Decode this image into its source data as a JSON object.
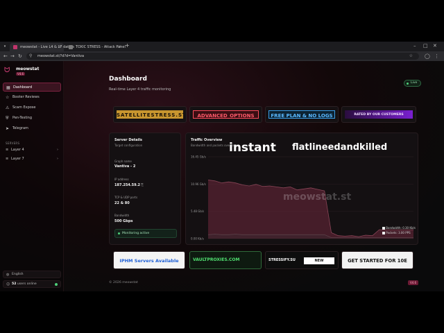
{
  "browser": {
    "tabs": [
      {
        "title": "meowstat - Live L4 & L7 datats",
        "active": true
      },
      {
        "title": "TOXIC STRESS - Attack Panel",
        "active": false
      }
    ],
    "url": "meowstat.st/?d?d=Vantiva"
  },
  "brand": {
    "name": "meowstat",
    "version": "V4.6"
  },
  "sidebar": {
    "items": [
      {
        "label": "Dashboard",
        "icon": "grid-icon",
        "active": true
      },
      {
        "label": "Booter Reviews",
        "icon": "star-icon",
        "active": false
      },
      {
        "label": "Scam Expose",
        "icon": "alert-icon",
        "active": false
      },
      {
        "label": "Pen-Testing",
        "icon": "shield-icon",
        "active": false
      },
      {
        "label": "Telegram",
        "icon": "send-icon",
        "active": false
      }
    ],
    "servers_label": "SERVERS",
    "servers": [
      {
        "label": "Layer 4",
        "icon": "layers-icon"
      },
      {
        "label": "Layer 7",
        "icon": "layers-icon"
      }
    ],
    "language": "English",
    "users_count": "52",
    "users_suffix": "users online"
  },
  "header": {
    "title": "Dashboard",
    "subtitle": "Real-time Layer 4 traffic monitoring",
    "live": "Live"
  },
  "banners_top": [
    {
      "label": "SATELLITESTRESS.ST",
      "color": "#d4a03a"
    },
    {
      "label": "ADVANCED_OPTIONS",
      "color": "#ff5a6a"
    },
    {
      "label": "FREE PLAN & NO LOGS",
      "color": "#5ab8ff"
    },
    {
      "label": "RATED BY OUR CUSTOMERS",
      "color": "#b04cff"
    }
  ],
  "server_details": {
    "title": "Server Details",
    "subtitle": "Target configuration",
    "fields": [
      {
        "label": "Graph name",
        "value": "Vantiva - 2"
      },
      {
        "label": "IP address",
        "value": "187.254.59.2"
      },
      {
        "label": "TCP & UDP ports",
        "value": "22 & 80"
      },
      {
        "label": "Bandwidth",
        "value": "500 Gbps"
      }
    ],
    "status": "Monitoring active"
  },
  "traffic": {
    "title": "Traffic Overview",
    "subtitle": "Bandwidth and packets over time",
    "watermark": "meowstat.st",
    "overlay_left": "instant",
    "overlay_right": "flatlineedandkilled",
    "legend": [
      {
        "label": "Bandwidth: 0.30 Kb/s"
      },
      {
        "label": "Packets: 3.00 PPS"
      }
    ]
  },
  "chart_data": {
    "type": "line",
    "yticks": [
      "16.45 Gb/s",
      "10.96 Gb/s",
      "5.48 Gb/s",
      "0.00 Kb/s"
    ],
    "ylim": [
      0,
      16.45
    ],
    "series": [
      {
        "name": "Bandwidth",
        "color": "#6b3644",
        "values": [
          11.8,
          11.6,
          11.2,
          11.4,
          11.2,
          10.8,
          10.6,
          10.9,
          10.5,
          10.6,
          10.4,
          10.2,
          10.4,
          9.8,
          10.0,
          10.2,
          9.9,
          9.6,
          1.2,
          0.6,
          0.5,
          0.6,
          0.4,
          0.7,
          0.6,
          1.8,
          1.8,
          1.8,
          1.8,
          1.8,
          1.8
        ]
      },
      {
        "name": "Packets",
        "color": "#3a2a30",
        "values": [
          0.8,
          0.9,
          0.8,
          0.8,
          0.9,
          0.8,
          0.8,
          0.8,
          0.8,
          0.8,
          0.8,
          0.8,
          0.8,
          0.8,
          0.8,
          0.8,
          0.8,
          0.8,
          0.2,
          0.2,
          0.2,
          0.2,
          0.2,
          0.2,
          0.2,
          0.2,
          0.2,
          0.2,
          0.2,
          0.2,
          0.2
        ]
      }
    ]
  },
  "banners_bottom": [
    {
      "label": "IPHM Servers Available",
      "color": "#1f5fd6"
    },
    {
      "label": "VAULTPROXIES.COM",
      "color": "#50e070"
    },
    {
      "label": "STRESSIFY.SU",
      "color": "#ffffff"
    },
    {
      "label": "GET STARTED FOR 10E",
      "color": "#111111"
    }
  ],
  "footer": {
    "text": "© 2026 meowstat",
    "badge": "V4.6"
  }
}
